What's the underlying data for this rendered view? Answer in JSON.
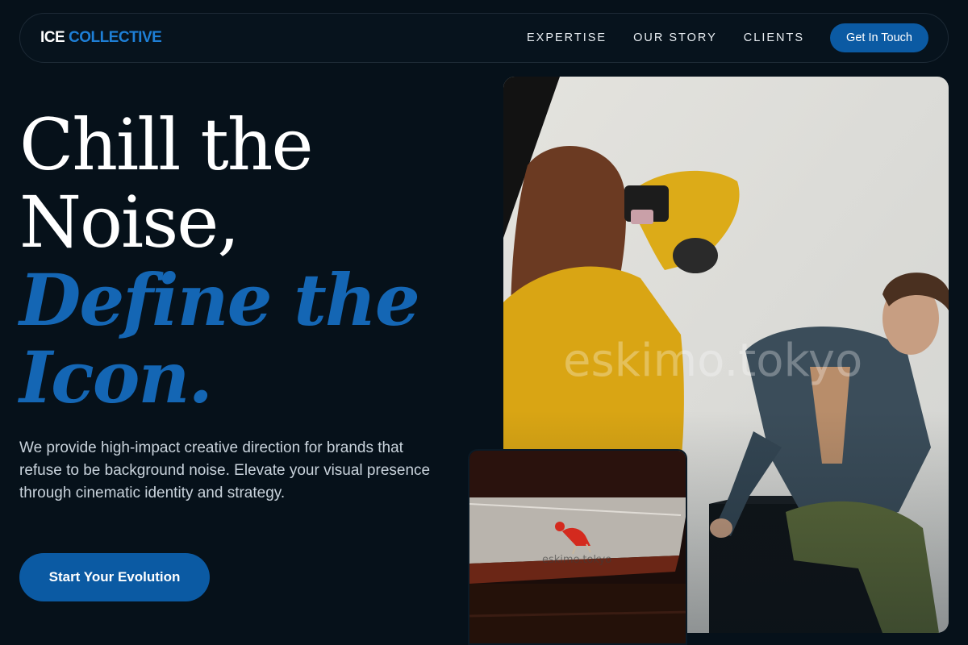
{
  "nav": {
    "logo_part1": "ICE",
    "logo_part2": "COLLECTIVE",
    "links": [
      "EXPERTISE",
      "OUR STORY",
      "CLIENTS"
    ],
    "cta": "Get In Touch"
  },
  "hero": {
    "line1": "Chill the",
    "line2": "Noise,",
    "line3": "Define the",
    "line4": "Icon.",
    "subtext": "We provide high-impact creative direction for brands that refuse to be background noise. Elevate your visual presence through cinematic identity and strategy.",
    "cta": "Start Your Evolution"
  },
  "images": {
    "main_alt": "Photographer in yellow sweater shooting a model in denim jacket seated on a black cube",
    "main_watermark": "eskimo.tokyo",
    "inset_alt": "Figure in red outfit on a gray platform seen from above",
    "inset_watermark": "eskimo.tokyo"
  },
  "colors": {
    "background": "#06111a",
    "accent": "#0b5aa3",
    "headline_blue": "#1466b4",
    "logo_blue": "#1e7fd6"
  }
}
